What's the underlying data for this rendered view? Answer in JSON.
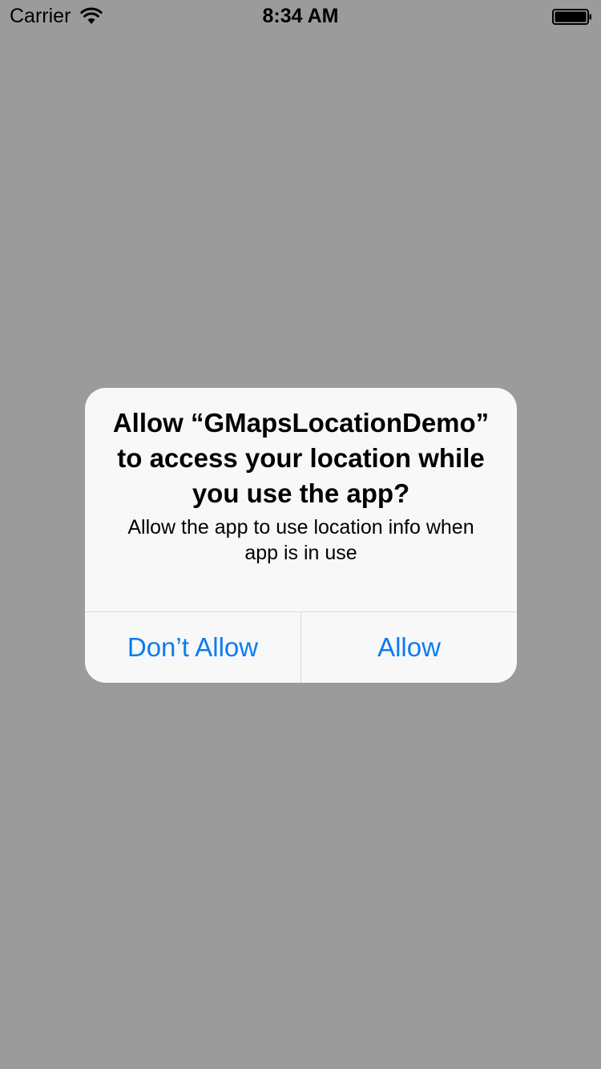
{
  "status_bar": {
    "carrier": "Carrier",
    "time": "8:34 AM",
    "wifi_icon": "wifi-icon",
    "battery_icon": "battery-full-icon"
  },
  "alert": {
    "title_line1": "Allow “GMapsLocationDemo”",
    "title_line2": "to access your location while",
    "title_line3": "you use the app?",
    "message_line1": "Allow the app to use location info when",
    "message_line2": "app is in use",
    "dont_allow_label": "Don’t Allow",
    "allow_label": "Allow"
  },
  "colors": {
    "background": "#9b9b9b",
    "alert_background": "#f8f8f8",
    "button_text": "#0a7cf1",
    "divider": "#dbdbdf"
  }
}
